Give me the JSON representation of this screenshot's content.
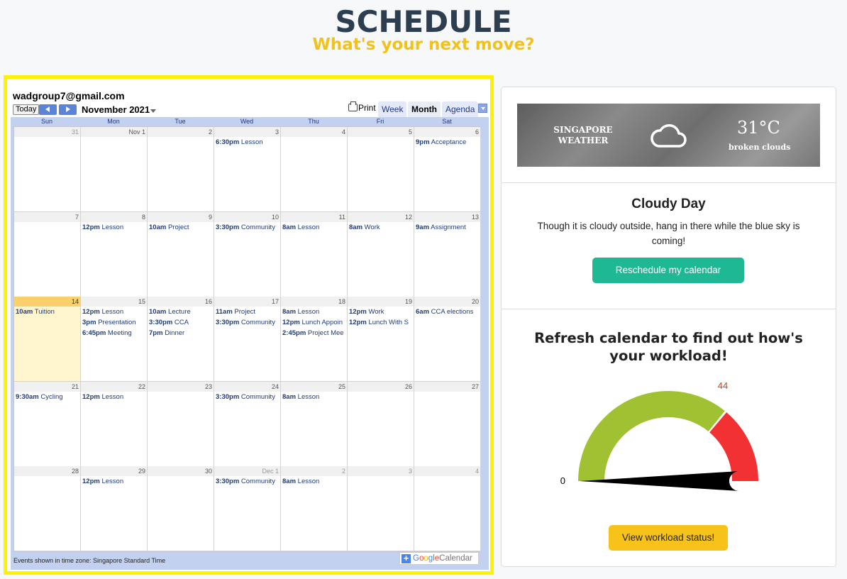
{
  "header": {
    "title": "SCHEDULE",
    "subtitle": "What's your next move?"
  },
  "calendar": {
    "owner": "wadgroup7@gmail.com",
    "today_label": "Today",
    "month_label": "November 2021",
    "print_label": "Print",
    "views": {
      "week": "Week",
      "month": "Month",
      "agenda": "Agenda"
    },
    "active_view": "Month",
    "weekdays": [
      "Sun",
      "Mon",
      "Tue",
      "Wed",
      "Thu",
      "Fri",
      "Sat"
    ],
    "weeks": [
      [
        {
          "day": "31",
          "other": true,
          "events": []
        },
        {
          "day": "Nov 1",
          "other": false,
          "events": []
        },
        {
          "day": "2",
          "other": false,
          "events": []
        },
        {
          "day": "3",
          "other": false,
          "events": [
            {
              "time": "6:30pm",
              "title": "Lesson"
            }
          ]
        },
        {
          "day": "4",
          "other": false,
          "events": []
        },
        {
          "day": "5",
          "other": false,
          "events": []
        },
        {
          "day": "6",
          "other": false,
          "events": [
            {
              "time": "9pm",
              "title": "Acceptance"
            }
          ]
        }
      ],
      [
        {
          "day": "7",
          "other": false,
          "events": []
        },
        {
          "day": "8",
          "other": false,
          "events": [
            {
              "time": "12pm",
              "title": "Lesson"
            }
          ]
        },
        {
          "day": "9",
          "other": false,
          "events": [
            {
              "time": "10am",
              "title": "Project"
            }
          ]
        },
        {
          "day": "10",
          "other": false,
          "events": [
            {
              "time": "3:30pm",
              "title": "Community"
            }
          ]
        },
        {
          "day": "11",
          "other": false,
          "events": [
            {
              "time": "8am",
              "title": "Lesson"
            }
          ]
        },
        {
          "day": "12",
          "other": false,
          "events": [
            {
              "time": "8am",
              "title": "Work"
            }
          ]
        },
        {
          "day": "13",
          "other": false,
          "events": [
            {
              "time": "9am",
              "title": "Assignment"
            }
          ]
        }
      ],
      [
        {
          "day": "14",
          "other": false,
          "today": true,
          "events": [
            {
              "time": "10am",
              "title": "Tuition"
            }
          ]
        },
        {
          "day": "15",
          "other": false,
          "events": [
            {
              "time": "12pm",
              "title": "Lesson"
            },
            {
              "time": "3pm",
              "title": "Presentation"
            },
            {
              "time": "6:45pm",
              "title": "Meeting"
            }
          ]
        },
        {
          "day": "16",
          "other": false,
          "events": [
            {
              "time": "10am",
              "title": "Lecture"
            },
            {
              "time": "3:30pm",
              "title": "CCA"
            },
            {
              "time": "7pm",
              "title": "Dinner"
            }
          ]
        },
        {
          "day": "17",
          "other": false,
          "events": [
            {
              "time": "11am",
              "title": "Project"
            },
            {
              "time": "3:30pm",
              "title": "Community"
            }
          ]
        },
        {
          "day": "18",
          "other": false,
          "events": [
            {
              "time": "8am",
              "title": "Lesson"
            },
            {
              "time": "12pm",
              "title": "Lunch Appoin"
            },
            {
              "time": "2:45pm",
              "title": "Project Mee"
            }
          ]
        },
        {
          "day": "19",
          "other": false,
          "events": [
            {
              "time": "12pm",
              "title": "Work"
            },
            {
              "time": "12pm",
              "title": "Lunch With S"
            }
          ]
        },
        {
          "day": "20",
          "other": false,
          "events": [
            {
              "time": "6am",
              "title": "CCA elections"
            }
          ]
        }
      ],
      [
        {
          "day": "21",
          "other": false,
          "events": [
            {
              "time": "9:30am",
              "title": "Cycling"
            }
          ]
        },
        {
          "day": "22",
          "other": false,
          "events": [
            {
              "time": "12pm",
              "title": "Lesson"
            }
          ]
        },
        {
          "day": "23",
          "other": false,
          "events": []
        },
        {
          "day": "24",
          "other": false,
          "events": [
            {
              "time": "3:30pm",
              "title": "Community"
            }
          ]
        },
        {
          "day": "25",
          "other": false,
          "events": [
            {
              "time": "8am",
              "title": "Lesson"
            }
          ]
        },
        {
          "day": "26",
          "other": false,
          "events": []
        },
        {
          "day": "27",
          "other": false,
          "events": []
        }
      ],
      [
        {
          "day": "28",
          "other": false,
          "events": []
        },
        {
          "day": "29",
          "other": false,
          "events": [
            {
              "time": "12pm",
              "title": "Lesson"
            }
          ]
        },
        {
          "day": "30",
          "other": false,
          "events": []
        },
        {
          "day": "Dec 1",
          "other": true,
          "events": [
            {
              "time": "3:30pm",
              "title": "Community"
            }
          ]
        },
        {
          "day": "2",
          "other": true,
          "events": [
            {
              "time": "8am",
              "title": "Lesson"
            }
          ]
        },
        {
          "day": "3",
          "other": true,
          "events": []
        },
        {
          "day": "4",
          "other": true,
          "events": []
        }
      ]
    ],
    "timezone_note": "Events shown in time zone: Singapore Standard Time",
    "badge": {
      "plus": "+",
      "google": "Google",
      "calendar": "Calendar"
    }
  },
  "weather": {
    "location": "SINGAPORE WEATHER",
    "temperature": "31°C",
    "description": "broken clouds",
    "icon": "cloud-icon"
  },
  "status": {
    "title": "Cloudy Day",
    "message": "Though it is cloudy outside, hang in there while the blue sky is coming!",
    "reschedule_label": "Reschedule my calendar"
  },
  "workload": {
    "title": "Refresh calendar to find out how's your workload!",
    "gauge": {
      "min_label": "0",
      "max_label": "44",
      "value": 0,
      "green_fraction": 0.72,
      "colors": {
        "green": "#a0c132",
        "red": "#f23232",
        "needle": "#000000"
      }
    },
    "button_label": "View workload status!"
  },
  "colors": {
    "title": "#2c3e50",
    "subtitle": "#f1c21b",
    "highlight_border": "#fff200",
    "reschedule_button": "#1fb895",
    "workload_button": "#f7c21a",
    "today_cell": "#fff6cf"
  }
}
